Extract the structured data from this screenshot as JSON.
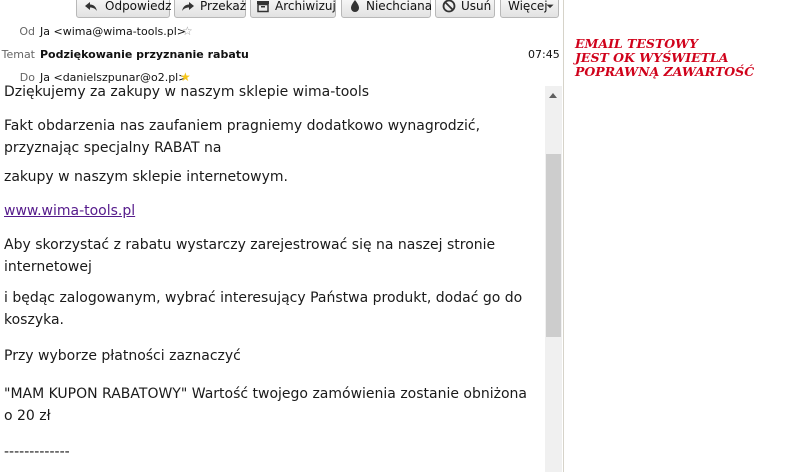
{
  "toolbar": {
    "reply": "Odpowiedz",
    "forward": "Przekaż",
    "archive": "Archiwizuj",
    "junk": "Niechciana",
    "delete": "Usuń",
    "more": "Więcej"
  },
  "header": {
    "from_label": "Od",
    "from_value": "Ja <wima@wima-tools.pl>",
    "subject_label": "Temat",
    "subject_value": "Podziękowanie przyznanie rabatu",
    "time": "07:45",
    "to_label": "Do",
    "to_value": "Ja <danielszpunar@o2.pl>"
  },
  "body": {
    "line0": "Dziękujemy za zakupy w naszym sklepie wima-tools",
    "para1": "Fakt obdarzenia nas zaufaniem pragniemy dodatkowo wynagrodzić, przyznając specjalny RABAT na",
    "para2": "zakupy w naszym sklepie internetowym.",
    "link": "www.wima-tools.pl",
    "para3": "Aby skorzystać z rabatu wystarczy zarejestrować się na naszej stronie internetowej",
    "para4": "i będąc zalogowanym, wybrać interesujący Państwa produkt, dodać go do koszyka.",
    "para5": "Przy wyborze płatności zaznaczyć",
    "para6": "\"MAM KUPON RABATOWY\" Wartość twojego zamówienia zostanie obniżona o 20 zł",
    "para7": "-------------"
  },
  "note": {
    "line1": "EMAIL TESTOWY",
    "line2": "JEST OK WYŚWIETLA",
    "line3": "POPRAWNĄ ZAWARTOŚĆ"
  },
  "colors": {
    "note": "#d0021b",
    "link": "#551a8b",
    "star_to": "#f5c518"
  },
  "icons": [
    "reply-icon",
    "forward-icon",
    "archive-icon",
    "junk-icon",
    "delete-icon",
    "star-icon",
    "chevron-down-icon"
  ]
}
